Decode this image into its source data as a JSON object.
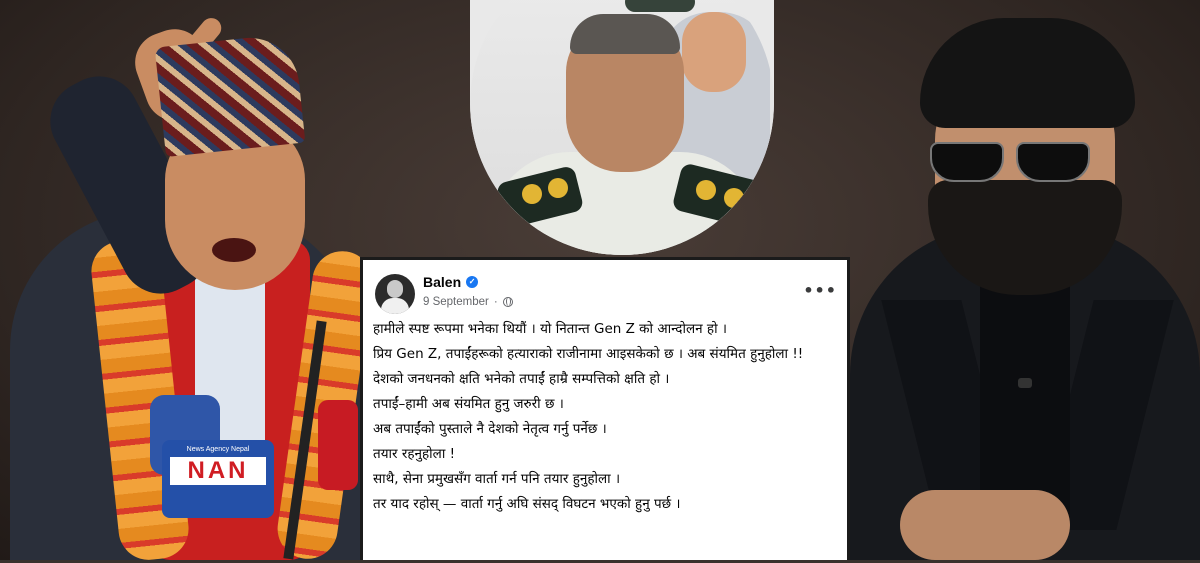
{
  "post": {
    "author": "Balen",
    "date": "9 September",
    "separator": "·",
    "verified_icon": "verified-badge-icon",
    "audience_icon": "globe-icon",
    "more_label": "•••",
    "lines": [
      "हामीले स्पष्ट रूपमा भनेका थियौं । यो नितान्त Gen Z को आन्दोलन हो ।",
      "प्रिय Gen Z, तपाईंहरूको हत्याराको राजीनामा आइसकेको छ । अब संयमित हुनुहोला !!",
      "देशको जनधनको क्षति भनेको तपाईं हाम्रै सम्पत्तिको क्षति हो ।",
      "तपाईं–हामी अब संयमित हुनु जरुरी छ ।",
      "अब तपाईंको पुस्ताले नै देशको नेतृत्व गर्नु पर्नेछ ।",
      "तयार रहनुहोला !",
      "साथै, सेना प्रमुखसँग वार्ता गर्न पनि  तयार हुनुहोला ।",
      "तर याद रहोस् — वार्ता गर्नु अघि संसद् विघटन भएको हुनु पर्छ ।"
    ]
  },
  "microphone_logo": {
    "small": "News Agency Nepal",
    "big": "NAN"
  },
  "colors": {
    "facebook_blue": "#1877f2",
    "background": "#3a302c",
    "scarf_red": "#c8201f"
  }
}
